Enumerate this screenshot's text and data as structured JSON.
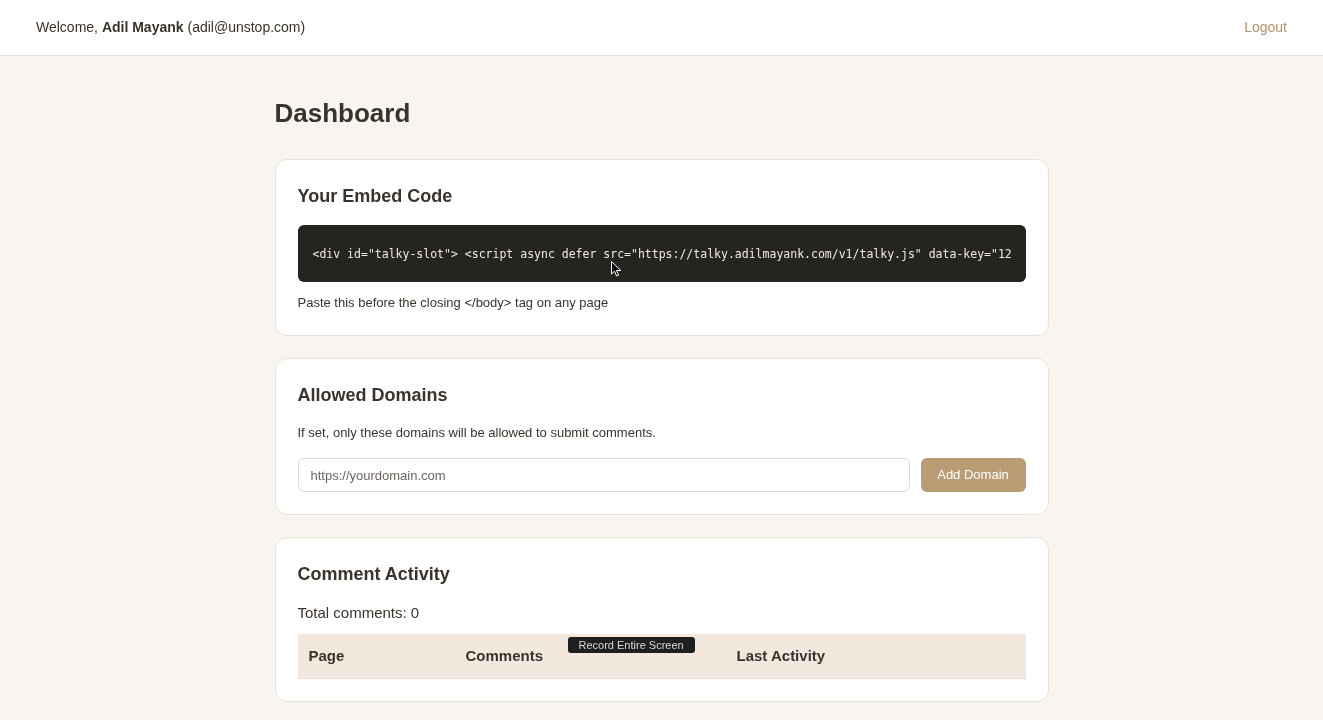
{
  "header": {
    "welcome": "Welcome, **Adil Mayank** (adil@unstop.com)",
    "logout": "Logout"
  },
  "page_title": "Dashboard",
  "embed_card": {
    "title": "Your Embed Code",
    "code": "<div id=\"talky-slot\"> <script async defer src=\"https://talky.adilmayank.com/v1/talky.js\" data-key=\"12",
    "note": "Paste this before the closing </body> tag on any page"
  },
  "domains_card": {
    "title": "Allowed Domains",
    "description": "If set, only these domains will be allowed to submit comments.",
    "input": {
      "placeholder": "https://yourdomain.com"
    },
    "button": "Add Domain"
  },
  "activity_card": {
    "title": "Comment Activity",
    "total": "Total comments: 0",
    "table": {
      "columns": [
        "Page",
        "Comments",
        "Last Activity"
      ]
    }
  },
  "tooltip": "Record Entire Screen"
}
